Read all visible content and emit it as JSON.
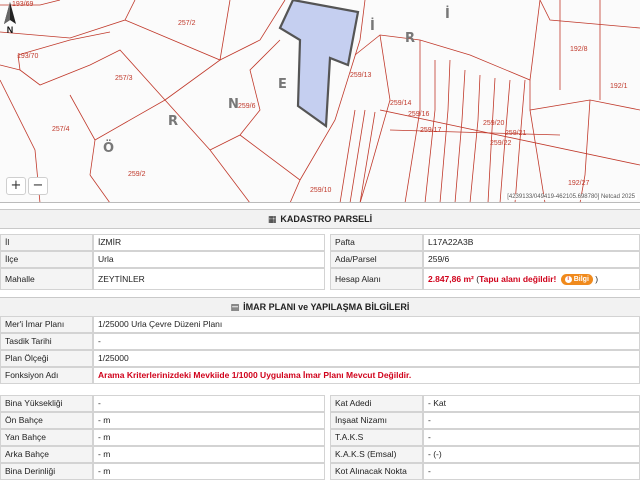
{
  "map": {
    "parcel_labels": [
      "193/69",
      "257/2",
      "193/70",
      "257/3",
      "257/4",
      "259/6",
      "259/13",
      "259/14",
      "259/16",
      "259/17",
      "259/20",
      "259/21",
      "259/22",
      "259/2",
      "259/10",
      "192/8",
      "192/27",
      "192/1"
    ],
    "place_letters": [
      "Ö",
      "R",
      "N",
      "E",
      "İ",
      "R",
      "İ"
    ],
    "highlighted_parcel": "259/6",
    "zoom_in_label": "+",
    "zoom_out_label": "−",
    "north_label": "N",
    "attribution": "[4239133/049419-462105.698780] Netcad 2025"
  },
  "kadastro": {
    "title": "KADASTRO PARSELİ",
    "il_label": "İl",
    "il_value": "İZMİR",
    "ilce_label": "İlçe",
    "ilce_value": "Urla",
    "mahalle_label": "Mahalle",
    "mahalle_value": "ZEYTİNLER",
    "pafta_label": "Pafta",
    "pafta_value": "L17A22A3B",
    "ada_label": "Ada/Parsel",
    "ada_value": "259/6",
    "hesap_label": "Hesap Alanı",
    "hesap_value": "2.847,86 m²",
    "tapu_open": "(",
    "tapu_warning": "Tapu alanı değildir!",
    "bilgi_label": "Bilgi",
    "tapu_close": ")"
  },
  "imar": {
    "title": "İMAR PLANI ve YAPILAŞMA BİLGİLERİ",
    "rows": [
      {
        "label": "Mer'i İmar Planı",
        "value": "1/25000 Urla Çevre Düzeni Planı"
      },
      {
        "label": "Tasdik Tarihi",
        "value": "-"
      },
      {
        "label": "Plan Ölçeği",
        "value": "1/25000"
      },
      {
        "label": "Fonksiyon Adı",
        "value": "Arama Kriterlerinizdeki Mevkiide 1/1000 Uygulama İmar Planı Mevcut Değildir."
      }
    ]
  },
  "yapilasma": {
    "left": [
      {
        "label": "Bina Yüksekliği",
        "value": "-"
      },
      {
        "label": "Ön Bahçe",
        "value": "- m"
      },
      {
        "label": "Yan Bahçe",
        "value": "- m"
      },
      {
        "label": "Arka Bahçe",
        "value": "- m"
      },
      {
        "label": "Bina Derinliği",
        "value": "- m"
      }
    ],
    "right": [
      {
        "label": "Kat Adedi",
        "value": "- Kat"
      },
      {
        "label": "İnşaat Nizamı",
        "value": "-"
      },
      {
        "label": "T.A.K.S",
        "value": "-"
      },
      {
        "label": "K.A.K.S (Emsal)",
        "value": "- (-)"
      },
      {
        "label": "Kot Alınacak Nokta",
        "value": "-"
      }
    ]
  },
  "colors": {
    "parcel_line": "#c0392b",
    "highlight_fill": "#c5cff0",
    "highlight_stroke": "#555555",
    "warning": "#d0021b",
    "badge": "#f08a1c"
  }
}
